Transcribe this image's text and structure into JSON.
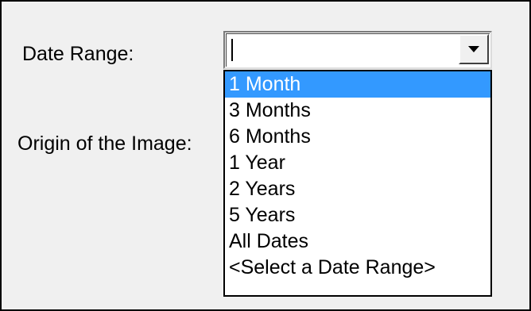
{
  "form": {
    "date_range_label": "Date Range:",
    "origin_label": "Origin of the Image:",
    "date_range_value": ""
  },
  "dropdown": {
    "icon": "chevron-down-icon",
    "selected_index": 0,
    "options": [
      "1 Month",
      "3 Months",
      "6 Months",
      "1 Year",
      "2 Years",
      "5 Years",
      "All Dates",
      "<Select a Date Range>"
    ]
  },
  "colors": {
    "highlight": "#3399ff",
    "highlight_text": "#ffffff",
    "dialog_background": "#f0f0f0"
  }
}
